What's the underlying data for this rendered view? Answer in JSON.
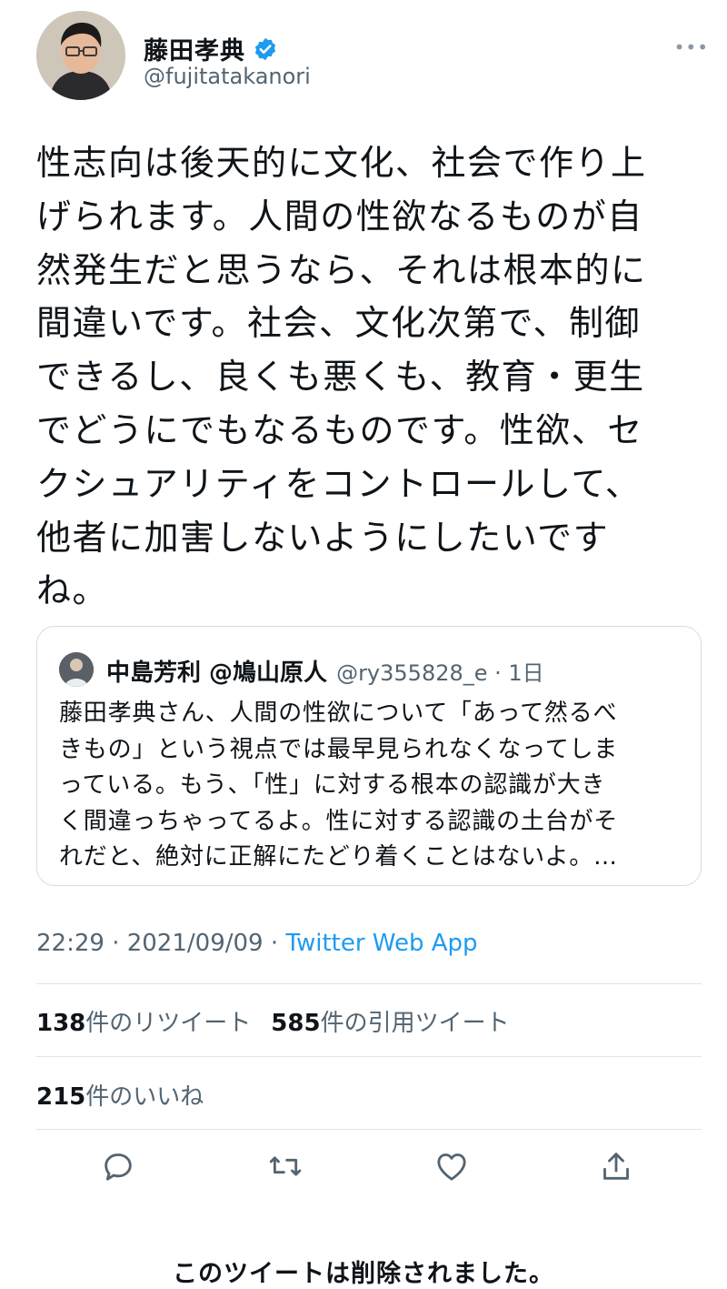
{
  "author": {
    "name": "藤田孝典",
    "handle": "@fujitatakanori",
    "verified_icon": "verified-badge-icon",
    "more_label": "•••"
  },
  "tweet": {
    "text": "性志向は後天的に文化、社会で作り上\nげられます。人間の性欲なるものが自\n然発生だと思うなら、それは根本的に\n間違いです。社会、文化次第で、制御\nできるし、良くも悪くも、教育・更生\nでどうにでもなるものです。性欲、セ\nクシュアリティをコントロールして、\n他者に加害しないようにしたいです\nね。"
  },
  "quote": {
    "name": "中島芳利 @鳩山原人",
    "meta": "@ry355828_e · 1日",
    "text": "藤田孝典さん、人間の性欲について「あって然るべ\nきもの」という視点では最早見られなくなってしま\nっている。もう、「性」に対する根本の認識が大き\nく間違っちゃってるよ。性に対する認識の土台がそ\nれだと、絶対に正解にたどり着くことはないよ。…"
  },
  "meta": {
    "time": "22:29 · 2021/09/09 · ",
    "app": "Twitter Web App"
  },
  "stats": {
    "retweets_count": "138",
    "retweets_label": "件のリツイート",
    "quotes_count": "585",
    "quotes_label": "件の引用ツイート",
    "likes_count": "215",
    "likes_label": "件のいいね"
  },
  "actions": [
    "reply-icon",
    "retweet-icon",
    "like-icon",
    "share-icon"
  ],
  "deleted_notice": "このツイートは削除されました。",
  "colors": {
    "link": "#1d9bf0",
    "muted": "#536471",
    "text": "#0f1419"
  }
}
